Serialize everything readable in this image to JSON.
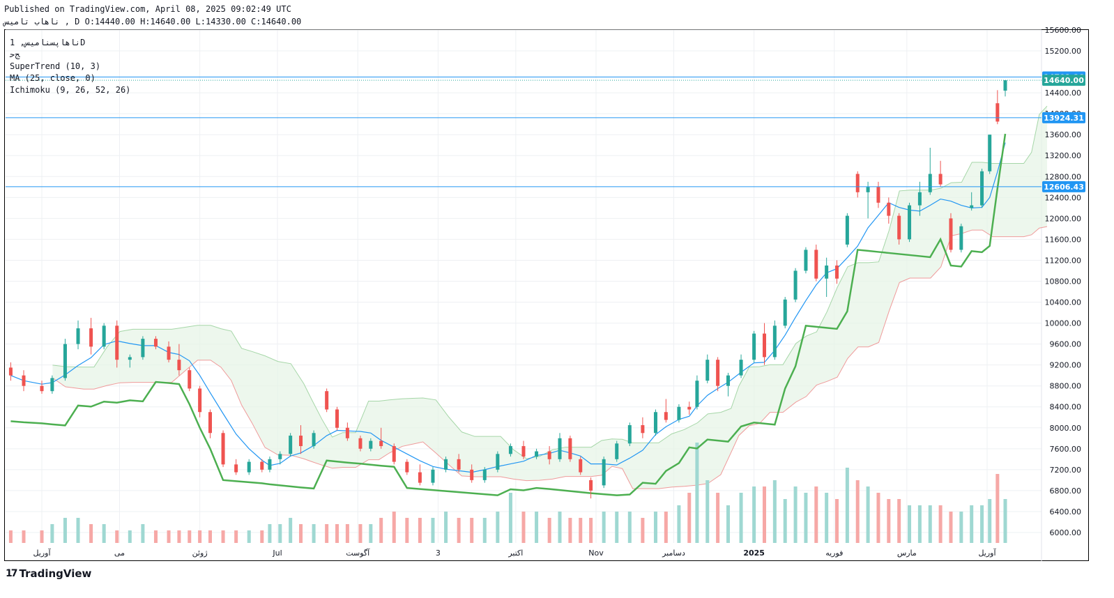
{
  "header": {
    "published": "Published on TradingView.com, April 08, 2025 09:02:49 UTC",
    "ohlc": "ناهاب تامیس , D O:14440.00 H:14640.00 L:14330.00 C:14640.00"
  },
  "legend": {
    "symbol": "ناهاپسنامیس, 1D",
    "market": "ﺞﺣ",
    "supertrend": "SuperTrend (10, 3)",
    "ma": "MA (25, close, 0)",
    "ichimoku": "Ichimoku (9, 26, 52, 26)"
  },
  "brand": {
    "logo": "17",
    "name": "TradingView"
  },
  "colors": {
    "up": "#26a69a",
    "down": "#ef5350",
    "upvol": "#9fd8d2",
    "downvol": "#f6a8a6",
    "st_up": "#4caf50",
    "st_down": "#a04444",
    "ma": "#2196f3",
    "cloud_up": "#e6f4e6",
    "cloud_down": "#fde1de",
    "hline": "#2196f3",
    "last": "#26a69a"
  },
  "chart_data": {
    "type": "candlestick",
    "ylim": [
      5800,
      15600
    ],
    "y_ticks": [
      "6000.00",
      "6400.00",
      "6800.00",
      "7200.00",
      "7600.00",
      "8000.00",
      "8400.00",
      "8800.00",
      "9200.00",
      "9600.00",
      "10000.00",
      "10400.00",
      "10800.00",
      "11200.00",
      "11600.00",
      "12000.00",
      "12400.00",
      "12800.00",
      "13200.00",
      "13600.00",
      "14000.00",
      "14400.00",
      "15200.00",
      "15600.00"
    ],
    "x_labels": [
      {
        "label": "آوریل",
        "date": "2024-04-01"
      },
      {
        "label": "می",
        "date": "2024-05-01"
      },
      {
        "label": "ژوئن",
        "date": "2024-06-01"
      },
      {
        "label": "Jul",
        "date": "2024-07-01"
      },
      {
        "label": "آگوست",
        "date": "2024-08-01"
      },
      {
        "label": "3",
        "date": "2024-09-01"
      },
      {
        "label": "اکتبر",
        "date": "2024-10-01"
      },
      {
        "label": "Nov",
        "date": "2024-11-01"
      },
      {
        "label": "دسامبر",
        "date": "2024-12-01"
      },
      {
        "label": "2025",
        "date": "2025-01-01"
      },
      {
        "label": "فوریه",
        "date": "2025-02-01"
      },
      {
        "label": "مارس",
        "date": "2025-03-01"
      },
      {
        "label": "آوریل",
        "date": "2025-04-01"
      }
    ],
    "price_labels": [
      {
        "value": 14701.86,
        "text": "14701.86",
        "color": "#2196f3"
      },
      {
        "value": 14640.0,
        "text": "14640.00",
        "color": "#26a69a"
      },
      {
        "value": 13924.31,
        "text": "13924.31",
        "color": "#2196f3"
      },
      {
        "value": 12606.43,
        "text": "12606.43",
        "color": "#2196f3"
      }
    ],
    "horizontal_lines": [
      14701.86,
      13924.31,
      12606.43
    ],
    "candles": [
      {
        "date": "2024-03-20",
        "o": 9150,
        "h": 9250,
        "l": 8900,
        "c": 9000,
        "v": 2
      },
      {
        "date": "2024-03-25",
        "o": 9000,
        "h": 9100,
        "l": 8700,
        "c": 8800,
        "v": 2
      },
      {
        "date": "2024-04-01",
        "o": 8800,
        "h": 8900,
        "l": 8650,
        "c": 8700,
        "v": 2
      },
      {
        "date": "2024-04-05",
        "o": 8700,
        "h": 9000,
        "l": 8650,
        "c": 8950,
        "v": 3
      },
      {
        "date": "2024-04-10",
        "o": 8950,
        "h": 9700,
        "l": 8900,
        "c": 9600,
        "v": 4
      },
      {
        "date": "2024-04-15",
        "o": 9600,
        "h": 10050,
        "l": 9500,
        "c": 9900,
        "v": 4
      },
      {
        "date": "2024-04-20",
        "o": 9900,
        "h": 10100,
        "l": 9400,
        "c": 9550,
        "v": 3
      },
      {
        "date": "2024-04-25",
        "o": 9550,
        "h": 10000,
        "l": 9500,
        "c": 9950,
        "v": 3
      },
      {
        "date": "2024-04-30",
        "o": 9950,
        "h": 10050,
        "l": 9150,
        "c": 9300,
        "v": 2
      },
      {
        "date": "2024-05-05",
        "o": 9300,
        "h": 9400,
        "l": 9150,
        "c": 9350,
        "v": 2
      },
      {
        "date": "2024-05-10",
        "o": 9350,
        "h": 9750,
        "l": 9300,
        "c": 9700,
        "v": 3
      },
      {
        "date": "2024-05-15",
        "o": 9700,
        "h": 9750,
        "l": 9500,
        "c": 9550,
        "v": 2
      },
      {
        "date": "2024-05-20",
        "o": 9550,
        "h": 9650,
        "l": 9250,
        "c": 9300,
        "v": 2
      },
      {
        "date": "2024-05-24",
        "o": 9300,
        "h": 9600,
        "l": 9000,
        "c": 9100,
        "v": 2
      },
      {
        "date": "2024-05-28",
        "o": 9100,
        "h": 9150,
        "l": 8700,
        "c": 8750,
        "v": 2
      },
      {
        "date": "2024-06-01",
        "o": 8750,
        "h": 8800,
        "l": 8200,
        "c": 8300,
        "v": 2
      },
      {
        "date": "2024-06-05",
        "o": 8300,
        "h": 8350,
        "l": 7800,
        "c": 7900,
        "v": 2
      },
      {
        "date": "2024-06-10",
        "o": 7900,
        "h": 7950,
        "l": 7250,
        "c": 7300,
        "v": 2
      },
      {
        "date": "2024-06-15",
        "o": 7300,
        "h": 7400,
        "l": 7100,
        "c": 7150,
        "v": 2
      },
      {
        "date": "2024-06-20",
        "o": 7150,
        "h": 7400,
        "l": 7100,
        "c": 7350,
        "v": 2
      },
      {
        "date": "2024-06-25",
        "o": 7350,
        "h": 7400,
        "l": 7150,
        "c": 7200,
        "v": 2
      },
      {
        "date": "2024-06-28",
        "o": 7200,
        "h": 7450,
        "l": 7150,
        "c": 7400,
        "v": 3
      },
      {
        "date": "2024-07-02",
        "o": 7400,
        "h": 7550,
        "l": 7300,
        "c": 7500,
        "v": 3
      },
      {
        "date": "2024-07-06",
        "o": 7500,
        "h": 7900,
        "l": 7450,
        "c": 7850,
        "v": 4
      },
      {
        "date": "2024-07-10",
        "o": 7850,
        "h": 8050,
        "l": 7500,
        "c": 7650,
        "v": 3
      },
      {
        "date": "2024-07-15",
        "o": 7650,
        "h": 7950,
        "l": 7600,
        "c": 7900,
        "v": 3
      },
      {
        "date": "2024-07-20",
        "o": 8700,
        "h": 8750,
        "l": 8300,
        "c": 8350,
        "v": 3
      },
      {
        "date": "2024-07-24",
        "o": 8350,
        "h": 8400,
        "l": 7950,
        "c": 8000,
        "v": 3
      },
      {
        "date": "2024-07-28",
        "o": 8000,
        "h": 8100,
        "l": 7750,
        "c": 7800,
        "v": 3
      },
      {
        "date": "2024-08-02",
        "o": 7800,
        "h": 7850,
        "l": 7550,
        "c": 7600,
        "v": 3
      },
      {
        "date": "2024-08-06",
        "o": 7600,
        "h": 7800,
        "l": 7550,
        "c": 7750,
        "v": 3
      },
      {
        "date": "2024-08-10",
        "o": 7750,
        "h": 8000,
        "l": 7600,
        "c": 7650,
        "v": 4
      },
      {
        "date": "2024-08-15",
        "o": 7650,
        "h": 7700,
        "l": 7300,
        "c": 7350,
        "v": 5
      },
      {
        "date": "2024-08-20",
        "o": 7350,
        "h": 7400,
        "l": 7100,
        "c": 7150,
        "v": 4
      },
      {
        "date": "2024-08-25",
        "o": 7150,
        "h": 7300,
        "l": 6900,
        "c": 6950,
        "v": 4
      },
      {
        "date": "2024-08-30",
        "o": 6950,
        "h": 7250,
        "l": 6900,
        "c": 7200,
        "v": 4
      },
      {
        "date": "2024-09-04",
        "o": 7200,
        "h": 7450,
        "l": 7150,
        "c": 7400,
        "v": 5
      },
      {
        "date": "2024-09-09",
        "o": 7400,
        "h": 7500,
        "l": 7150,
        "c": 7200,
        "v": 4
      },
      {
        "date": "2024-09-14",
        "o": 7200,
        "h": 7300,
        "l": 6950,
        "c": 7000,
        "v": 4
      },
      {
        "date": "2024-09-19",
        "o": 7000,
        "h": 7250,
        "l": 6950,
        "c": 7200,
        "v": 4
      },
      {
        "date": "2024-09-24",
        "o": 7200,
        "h": 7550,
        "l": 7150,
        "c": 7500,
        "v": 5
      },
      {
        "date": "2024-09-29",
        "o": 7500,
        "h": 7700,
        "l": 7450,
        "c": 7650,
        "v": 8
      },
      {
        "date": "2024-10-04",
        "o": 7650,
        "h": 7750,
        "l": 7400,
        "c": 7450,
        "v": 5
      },
      {
        "date": "2024-10-09",
        "o": 7450,
        "h": 7600,
        "l": 7400,
        "c": 7550,
        "v": 5
      },
      {
        "date": "2024-10-14",
        "o": 7550,
        "h": 7650,
        "l": 7300,
        "c": 7400,
        "v": 4
      },
      {
        "date": "2024-10-18",
        "o": 7400,
        "h": 7900,
        "l": 7350,
        "c": 7800,
        "v": 5
      },
      {
        "date": "2024-10-22",
        "o": 7800,
        "h": 7850,
        "l": 7350,
        "c": 7400,
        "v": 4
      },
      {
        "date": "2024-10-26",
        "o": 7400,
        "h": 7450,
        "l": 7100,
        "c": 7150,
        "v": 4
      },
      {
        "date": "2024-10-30",
        "o": 7000,
        "h": 7050,
        "l": 6650,
        "c": 6800,
        "v": 4
      },
      {
        "date": "2024-11-04",
        "o": 6900,
        "h": 7450,
        "l": 6850,
        "c": 7400,
        "v": 5
      },
      {
        "date": "2024-11-09",
        "o": 7400,
        "h": 7750,
        "l": 7350,
        "c": 7700,
        "v": 5
      },
      {
        "date": "2024-11-14",
        "o": 7700,
        "h": 8100,
        "l": 7650,
        "c": 8050,
        "v": 5
      },
      {
        "date": "2024-11-19",
        "o": 8050,
        "h": 8200,
        "l": 7800,
        "c": 7900,
        "v": 4
      },
      {
        "date": "2024-11-24",
        "o": 7900,
        "h": 8350,
        "l": 7850,
        "c": 8300,
        "v": 5
      },
      {
        "date": "2024-11-28",
        "o": 8300,
        "h": 8550,
        "l": 8100,
        "c": 8150,
        "v": 5
      },
      {
        "date": "2024-12-03",
        "o": 8150,
        "h": 8450,
        "l": 8100,
        "c": 8400,
        "v": 6
      },
      {
        "date": "2024-12-07",
        "o": 8400,
        "h": 8500,
        "l": 8250,
        "c": 8350,
        "v": 8
      },
      {
        "date": "2024-12-10",
        "o": 8400,
        "h": 9000,
        "l": 8350,
        "c": 8900,
        "v": 16
      },
      {
        "date": "2024-12-14",
        "o": 8900,
        "h": 9400,
        "l": 8850,
        "c": 9300,
        "v": 10
      },
      {
        "date": "2024-12-18",
        "o": 9300,
        "h": 9350,
        "l": 8700,
        "c": 8800,
        "v": 8
      },
      {
        "date": "2024-12-22",
        "o": 8800,
        "h": 9050,
        "l": 8600,
        "c": 9000,
        "v": 6
      },
      {
        "date": "2024-12-27",
        "o": 9000,
        "h": 9400,
        "l": 8950,
        "c": 9300,
        "v": 8
      },
      {
        "date": "2025-01-01",
        "o": 9300,
        "h": 9850,
        "l": 9250,
        "c": 9800,
        "v": 9
      },
      {
        "date": "2025-01-05",
        "o": 9800,
        "h": 10000,
        "l": 9200,
        "c": 9350,
        "v": 9
      },
      {
        "date": "2025-01-09",
        "o": 9350,
        "h": 10050,
        "l": 9300,
        "c": 9950,
        "v": 10
      },
      {
        "date": "2025-01-13",
        "o": 9950,
        "h": 10500,
        "l": 9900,
        "c": 10450,
        "v": 7
      },
      {
        "date": "2025-01-17",
        "o": 10450,
        "h": 11050,
        "l": 10400,
        "c": 11000,
        "v": 9
      },
      {
        "date": "2025-01-21",
        "o": 11000,
        "h": 11450,
        "l": 10950,
        "c": 11400,
        "v": 8
      },
      {
        "date": "2025-01-25",
        "o": 11400,
        "h": 11500,
        "l": 10800,
        "c": 10850,
        "v": 9
      },
      {
        "date": "2025-01-29",
        "o": 10850,
        "h": 11250,
        "l": 10500,
        "c": 11100,
        "v": 8
      },
      {
        "date": "2025-02-02",
        "o": 11100,
        "h": 11200,
        "l": 10750,
        "c": 10850,
        "v": 7
      },
      {
        "date": "2025-02-06",
        "o": 11500,
        "h": 12100,
        "l": 11450,
        "c": 12050,
        "v": 12
      },
      {
        "date": "2025-02-10",
        "o": 12850,
        "h": 12900,
        "l": 12400,
        "c": 12500,
        "v": 10
      },
      {
        "date": "2025-02-14",
        "o": 12500,
        "h": 12700,
        "l": 12000,
        "c": 12600,
        "v": 9
      },
      {
        "date": "2025-02-18",
        "o": 12600,
        "h": 12700,
        "l": 12200,
        "c": 12300,
        "v": 8
      },
      {
        "date": "2025-02-22",
        "o": 12300,
        "h": 12400,
        "l": 11900,
        "c": 12050,
        "v": 7
      },
      {
        "date": "2025-02-26",
        "o": 12050,
        "h": 12100,
        "l": 11500,
        "c": 11600,
        "v": 7
      },
      {
        "date": "2025-03-02",
        "o": 11600,
        "h": 12300,
        "l": 11550,
        "c": 12250,
        "v": 6
      },
      {
        "date": "2025-03-06",
        "o": 12250,
        "h": 12700,
        "l": 12050,
        "c": 12500,
        "v": 6
      },
      {
        "date": "2025-03-10",
        "o": 12500,
        "h": 13350,
        "l": 12450,
        "c": 12850,
        "v": 6
      },
      {
        "date": "2025-03-14",
        "o": 12850,
        "h": 13100,
        "l": 12600,
        "c": 12650,
        "v": 6
      },
      {
        "date": "2025-03-18",
        "o": 12000,
        "h": 12100,
        "l": 11350,
        "c": 11400,
        "v": 5
      },
      {
        "date": "2025-03-22",
        "o": 11400,
        "h": 11900,
        "l": 11350,
        "c": 11850,
        "v": 5
      },
      {
        "date": "2025-03-26",
        "o": 12200,
        "h": 12500,
        "l": 12150,
        "c": 12250,
        "v": 6
      },
      {
        "date": "2025-03-30",
        "o": 12250,
        "h": 12950,
        "l": 12200,
        "c": 12900,
        "v": 6
      },
      {
        "date": "2025-04-02",
        "o": 12900,
        "h": 13600,
        "l": 12850,
        "c": 13600,
        "v": 7
      },
      {
        "date": "2025-04-05",
        "o": 14200,
        "h": 14450,
        "l": 13800,
        "c": 13850,
        "v": 11
      },
      {
        "date": "2025-04-08",
        "o": 14440,
        "h": 14640,
        "l": 14330,
        "c": 14640,
        "v": 7
      }
    ]
  }
}
